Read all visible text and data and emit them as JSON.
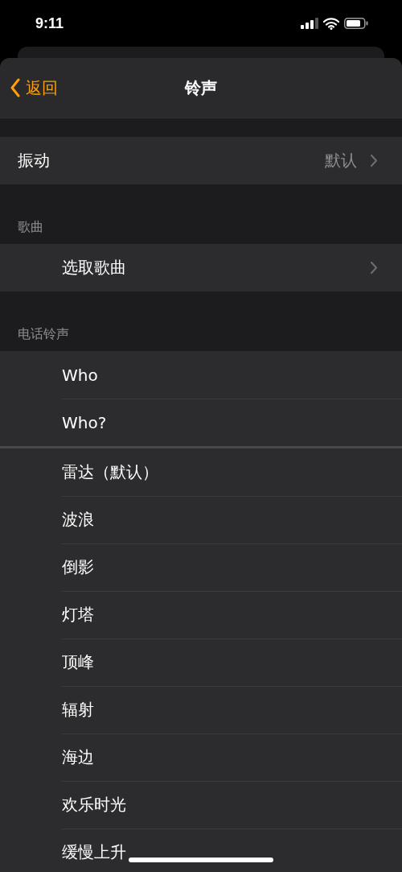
{
  "status_bar": {
    "time": "9:11"
  },
  "nav_bar": {
    "back_label": "返回",
    "title": "铃声"
  },
  "vibration": {
    "label": "振动",
    "value": "默认"
  },
  "songs": {
    "header": "歌曲",
    "items": [
      {
        "label": "选取歌曲"
      }
    ]
  },
  "ringtones": {
    "header": "电话铃声",
    "groups": [
      {
        "items": [
          {
            "label": "Who",
            "selected": false
          },
          {
            "label": "Who?",
            "selected": false
          }
        ]
      },
      {
        "items": [
          {
            "label": "雷达（默认）",
            "selected": false
          },
          {
            "label": "波浪",
            "selected": false
          },
          {
            "label": "倒影",
            "selected": false
          },
          {
            "label": "灯塔",
            "selected": false
          },
          {
            "label": "顶峰",
            "selected": false
          },
          {
            "label": "辐射",
            "selected": false
          },
          {
            "label": "海边",
            "selected": false
          },
          {
            "label": "欢乐时光",
            "selected": false
          },
          {
            "label": "缓慢上升",
            "selected": false
          }
        ]
      }
    ]
  }
}
